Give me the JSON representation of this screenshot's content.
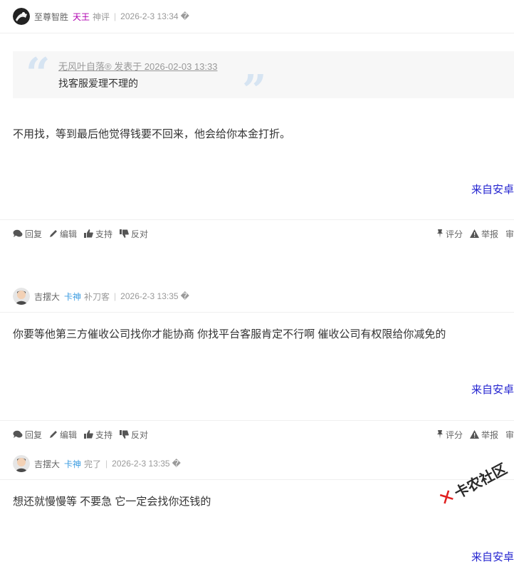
{
  "posts": [
    {
      "author": "至尊智胜",
      "badge": "天王",
      "badge_color": "#b000b0",
      "title": "神评",
      "time": "2026-2-3 13:34",
      "extra": "�",
      "quote": {
        "head": "无风叶自落® 发表于 2026-02-03 13:33",
        "body": "找客服爱理不理的"
      },
      "message": "不用找，等到最后他觉得钱要不回来，他会给你本金打折。",
      "from": "来自安卓"
    },
    {
      "author": "吉摆大",
      "badge": "卡神",
      "badge_color": "#3a9be0",
      "title": "补刀客",
      "time": "2026-2-3 13:35",
      "extra": "�",
      "message": "你要等他第三方催收公司找你才能协商 你找平台客服肯定不行啊 催收公司有权限给你减免的",
      "from": "来自安卓"
    },
    {
      "author": "吉摆大",
      "badge": "卡神",
      "badge_color": "#3a9be0",
      "title": "完了",
      "time": "2026-2-3 13:35",
      "extra": "�",
      "message": "想还就慢慢等 不要急 它一定会找你还钱的",
      "from": "来自安卓"
    }
  ],
  "actions": {
    "reply": "回复",
    "edit": "编辑",
    "support": "支持",
    "oppose": "反对",
    "rate": "评分",
    "report": "举报",
    "more": "审"
  },
  "watermark": "卡农社区"
}
